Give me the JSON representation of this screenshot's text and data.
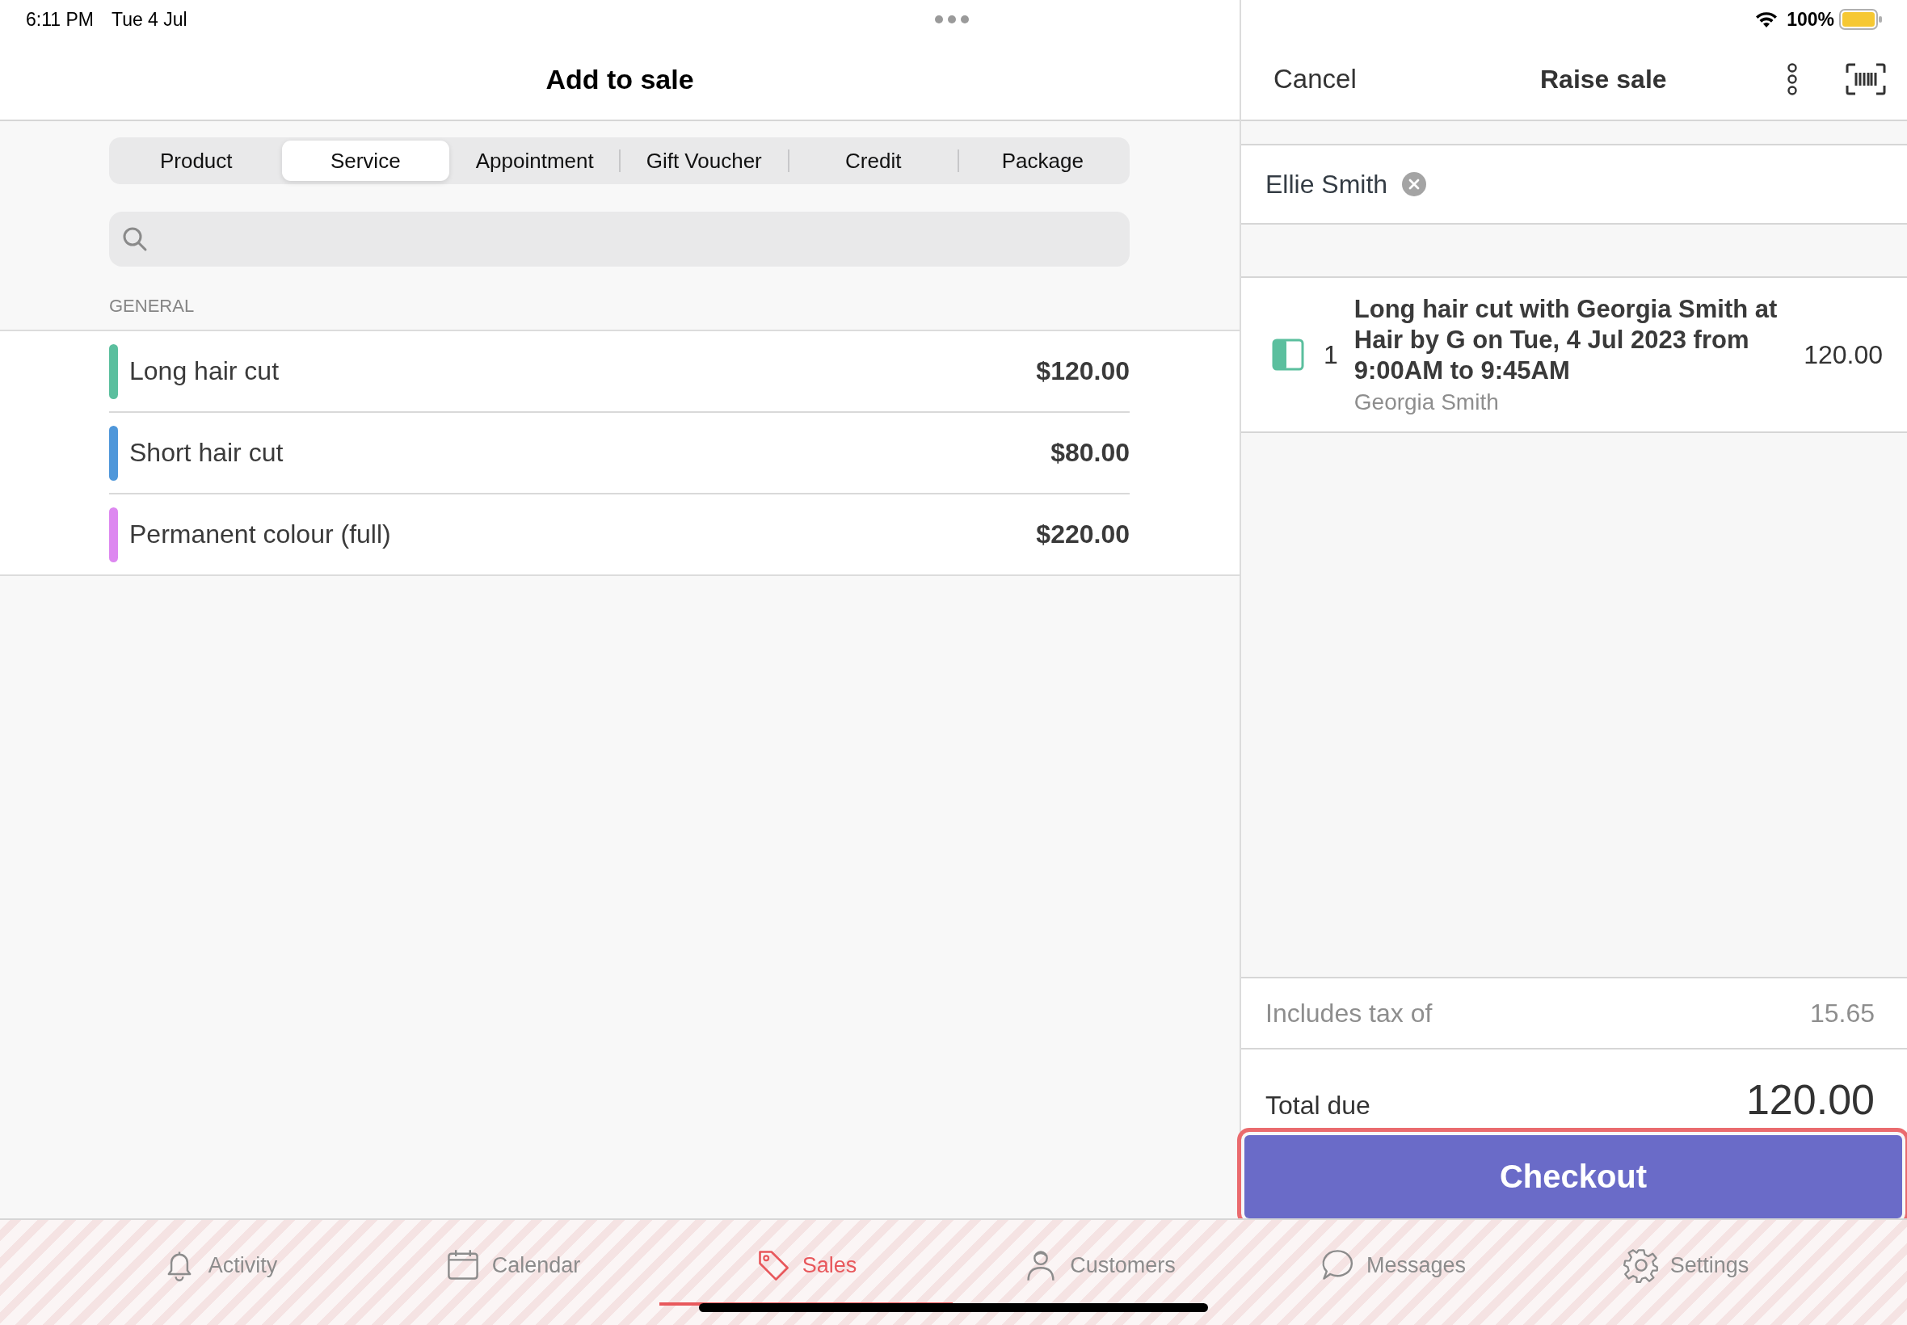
{
  "status_bar": {
    "time": "6:11 PM",
    "date": "Tue 4 Jul",
    "battery": "100%"
  },
  "add_panel": {
    "title": "Add to sale",
    "tabs": [
      {
        "label": "Product",
        "selected": false
      },
      {
        "label": "Service",
        "selected": true
      },
      {
        "label": "Appointment",
        "selected": false
      },
      {
        "label": "Gift Voucher",
        "selected": false
      },
      {
        "label": "Credit",
        "selected": false
      },
      {
        "label": "Package",
        "selected": false
      }
    ],
    "section": "GENERAL",
    "services": [
      {
        "name": "Long hair cut",
        "price": "$120.00",
        "color": "#5bbf9e"
      },
      {
        "name": "Short hair cut",
        "price": "$80.00",
        "color": "#4f97da"
      },
      {
        "name": "Permanent colour (full)",
        "price": "$220.00",
        "color": "#dd88f0"
      }
    ]
  },
  "sale_panel": {
    "cancel": "Cancel",
    "title": "Raise sale",
    "client": "Ellie Smith",
    "items": [
      {
        "quantity": "1",
        "description": "Long hair cut with Georgia Smith at Hair by G on Tue, 4 Jul 2023 from 9:00AM to 9:45AM",
        "staff": "Georgia Smith",
        "amount": "120.00",
        "color": "#5bbf9e"
      }
    ],
    "tax_label": "Includes tax of",
    "tax": "15.65",
    "total_label": "Total due",
    "total": "120.00",
    "checkout": "Checkout"
  },
  "tab_bar": [
    {
      "label": "Activity",
      "kind": "bell",
      "selected": false
    },
    {
      "label": "Calendar",
      "kind": "calendar",
      "selected": false
    },
    {
      "label": "Sales",
      "kind": "tag",
      "selected": true
    },
    {
      "label": "Customers",
      "kind": "person",
      "selected": false
    },
    {
      "label": "Messages",
      "kind": "bubble",
      "selected": false
    },
    {
      "label": "Settings",
      "kind": "gear",
      "selected": false
    }
  ]
}
